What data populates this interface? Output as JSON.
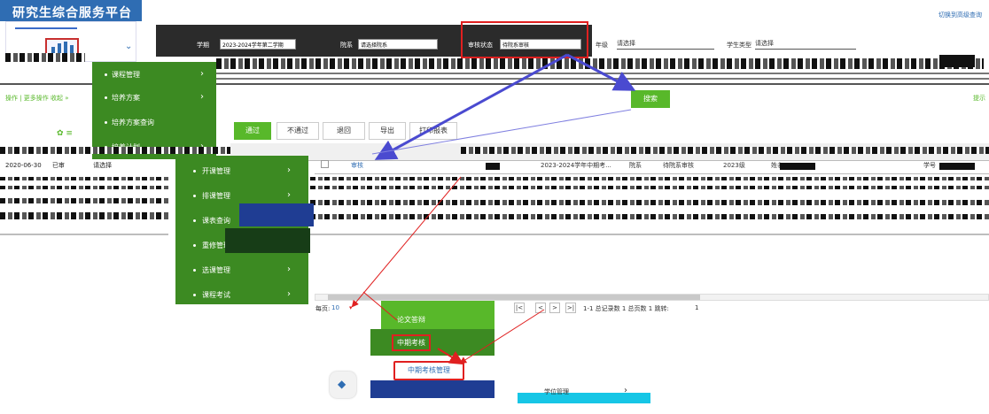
{
  "header": {
    "title": "研究生综合服务平台",
    "switch_link": "切换到高级查询"
  },
  "filters": [
    {
      "label": "学期",
      "value": "2023-2024学年第二学期"
    },
    {
      "label": "院系",
      "value": "请选择院系"
    },
    {
      "label": "审核状态",
      "value": "待院系审核"
    },
    {
      "label": "年级",
      "value": "请选择"
    },
    {
      "label": "学生类型",
      "value": "请选择"
    }
  ],
  "search_label": "搜索",
  "breadcrumb": "操作 | 更多操作   收起 »",
  "right_note": "提示",
  "left_menu": [
    {
      "label": "课程管理",
      "arrow": "›"
    },
    {
      "label": "培养方案",
      "arrow": "›"
    },
    {
      "label": "培养方案查询",
      "arrow": ""
    },
    {
      "label": "培养计划",
      "arrow": "›"
    }
  ],
  "sub_menu": [
    {
      "label": "开课管理",
      "arrow": "›"
    },
    {
      "label": "排课管理",
      "arrow": "›"
    },
    {
      "label": "课表查询",
      "arrow": "›"
    },
    {
      "label": "重修管理",
      "arrow": "›"
    },
    {
      "label": "选课管理",
      "arrow": "›"
    },
    {
      "label": "课程考试",
      "arrow": "›"
    }
  ],
  "toolbar": {
    "pass": "通过",
    "fail": "不通过",
    "return": "退回",
    "export": "导出",
    "print": "打印报表"
  },
  "table_row": {
    "left_date": "2020-06-30",
    "left_col1": "已审",
    "left_col2": "请选择",
    "audit": "审核",
    "term": "2023-2024学年中期考...",
    "dept": "院系",
    "status": "待院系审核",
    "grade": "2023级",
    "name": "姓名",
    "extra": "学号"
  },
  "pager": {
    "per_page_label": "每页:",
    "per_page_value": "10",
    "first": "|<",
    "prev": "<",
    "next": ">",
    "last": ">|",
    "info": "1-1 总记录数 1   总页数 1   跳转:",
    "jump": "1"
  },
  "bottom": {
    "mid_exam_btn": "中期考核",
    "mid_exam_mgmt": "中期考核管理",
    "dup_item": "论文答辩",
    "last_item": "学位管理",
    "last_arrow": "›"
  },
  "colors": {
    "green": "#3c8a22",
    "green_light": "#58b82a",
    "blue": "#2f6db3",
    "red": "#e02020"
  }
}
